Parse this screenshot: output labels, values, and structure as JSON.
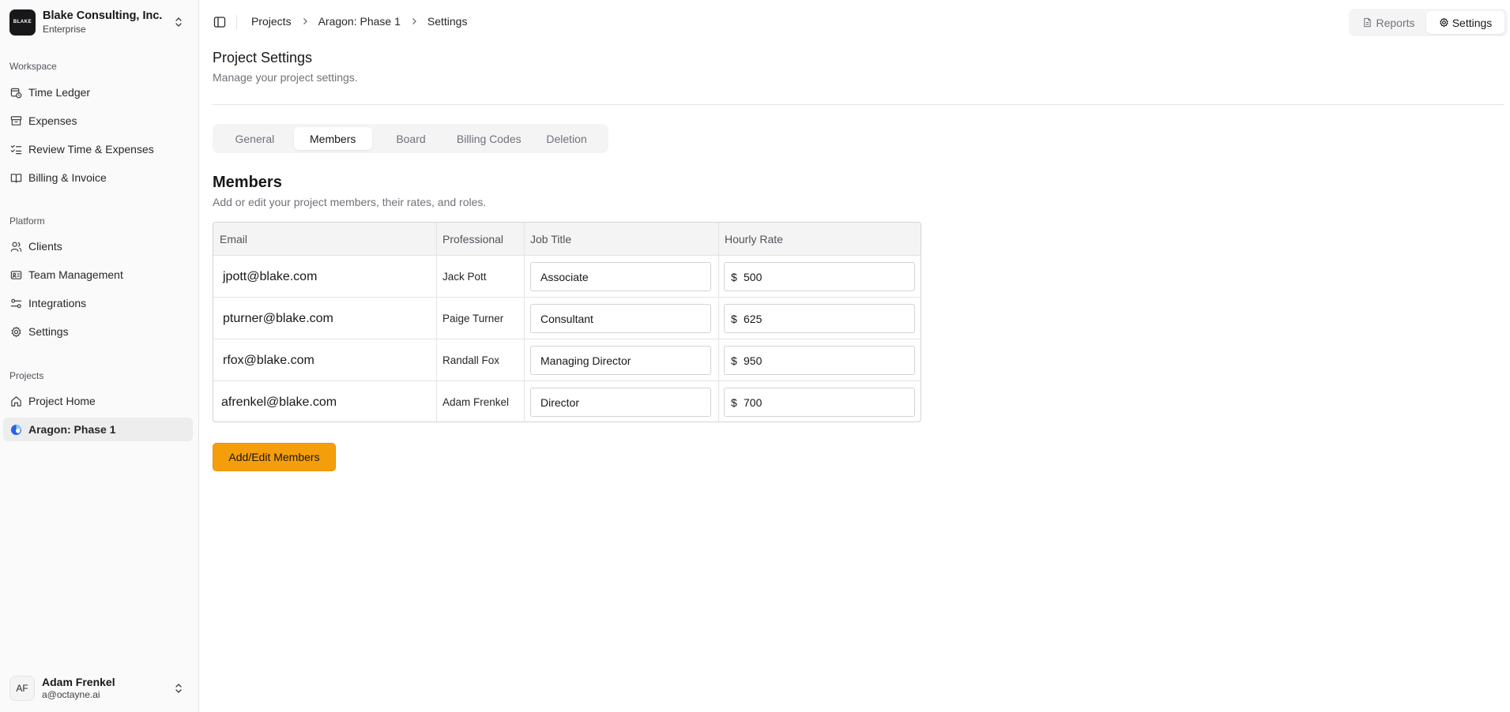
{
  "org": {
    "logo_text": "BLAKE",
    "name": "Blake Consulting, Inc.",
    "plan": "Enterprise"
  },
  "sidebar": {
    "workspace_label": "Workspace",
    "workspace_items": [
      {
        "label": "Time Ledger",
        "icon": "calendar-clock-icon"
      },
      {
        "label": "Expenses",
        "icon": "archive-icon"
      },
      {
        "label": "Review Time & Expenses",
        "icon": "list-checks-icon"
      },
      {
        "label": "Billing & Invoice",
        "icon": "book-open-icon"
      }
    ],
    "platform_label": "Platform",
    "platform_items": [
      {
        "label": "Clients",
        "icon": "users-icon"
      },
      {
        "label": "Team Management",
        "icon": "id-card-icon"
      },
      {
        "label": "Integrations",
        "icon": "sliders-icon"
      },
      {
        "label": "Settings",
        "icon": "gear-icon"
      }
    ],
    "projects_label": "Projects",
    "project_items": [
      {
        "label": "Project Home",
        "icon": "home-icon"
      },
      {
        "label": "Aragon: Phase 1",
        "icon": "project-dot-icon",
        "active": true
      }
    ]
  },
  "user": {
    "initials": "AF",
    "name": "Adam Frenkel",
    "email": "a@octayne.ai"
  },
  "breadcrumb": [
    "Projects",
    "Aragon: Phase 1",
    "Settings"
  ],
  "view_switch": {
    "reports": "Reports",
    "settings": "Settings",
    "active": "Settings"
  },
  "page": {
    "title": "Project Settings",
    "subtitle": "Manage your project settings."
  },
  "tabs": [
    "General",
    "Members",
    "Board",
    "Billing Codes",
    "Deletion"
  ],
  "active_tab": "Members",
  "members": {
    "title": "Members",
    "subtitle": "Add or edit your project members, their rates, and roles.",
    "columns": [
      "Email",
      "Professional",
      "Job Title",
      "Hourly Rate"
    ],
    "currency": "$",
    "rows": [
      {
        "email": "jpott@blake.com",
        "professional": "Jack Pott",
        "job_title": "Associate",
        "rate": "500"
      },
      {
        "email": "pturner@blake.com",
        "professional": "Paige Turner",
        "job_title": "Consultant",
        "rate": "625"
      },
      {
        "email": "rfox@blake.com",
        "professional": "Randall Fox",
        "job_title": "Managing Director",
        "rate": "950"
      },
      {
        "email": "afrenkel@blake.com",
        "professional": "Adam Frenkel",
        "job_title": "Director",
        "rate": "700"
      }
    ],
    "button_label": "Add/Edit Members"
  },
  "colors": {
    "accent": "#f59e0b",
    "project_dot": "#2563eb"
  }
}
